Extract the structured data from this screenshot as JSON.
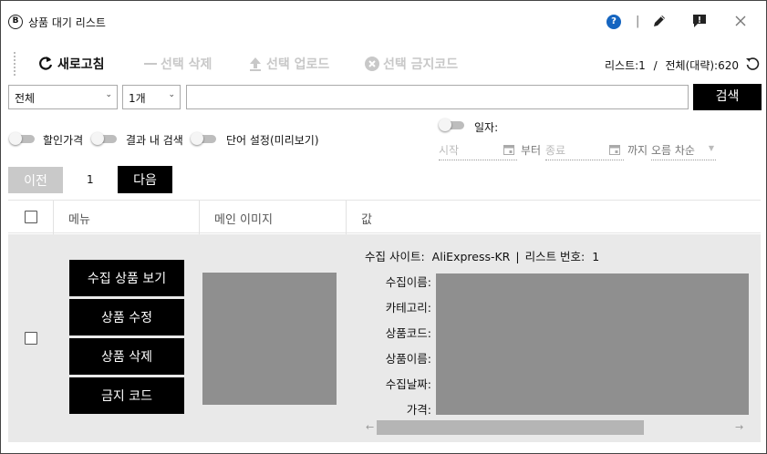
{
  "window": {
    "title": "상품 대기 리스트",
    "app_icon_glyph": "B",
    "help_glyph": "?",
    "separator": "|"
  },
  "toolbar": {
    "refresh_label": "새로고침",
    "delete_label": "선택 삭제",
    "upload_label": "선택 업로드",
    "ban_label": "선택 금지코드",
    "list_count": "리스트:1",
    "divider": "/",
    "total_count": "전체(대략):620"
  },
  "search": {
    "scope_value": "전체",
    "count_value": "1개",
    "query_value": "",
    "button_label": "검색"
  },
  "options": {
    "discount_price": {
      "label": "할인가격",
      "on": false
    },
    "search_in_results": {
      "label": "결과 내 검색",
      "on": false
    },
    "word_settings": {
      "label": "단어 설정(미리보기)",
      "on": false
    },
    "date": {
      "label": "일자:",
      "on": false
    }
  },
  "date_filter": {
    "start_placeholder": "시작",
    "from_label": "부터",
    "end_placeholder": "종료",
    "until_label": "까지",
    "sort_value": "오름 차순"
  },
  "pagination": {
    "prev_label": "이전",
    "current_page": "1",
    "next_label": "다음"
  },
  "table": {
    "headers": [
      "메뉴",
      "메인 이미지",
      "값"
    ],
    "rows": [
      {
        "menu_buttons": [
          "수집 상품 보기",
          "상품 수정",
          "상품 삭제",
          "금지 코드"
        ],
        "source_label": "수집 사이트:",
        "source_value": "AliExpress-KR",
        "list_no_label": "리스트 번호:",
        "list_no_value": "1",
        "field_labels": [
          "수집이름:",
          "카테고리:",
          "상품코드:",
          "상품이름:",
          "수집날짜:",
          "가격:"
        ]
      }
    ]
  },
  "colors": {
    "primary_button": "#000000",
    "disabled_button": "#c9c9c9",
    "help_icon": "#1565c0",
    "row_background": "#e9e9e9",
    "redacted_block": "#8f8f8f"
  }
}
